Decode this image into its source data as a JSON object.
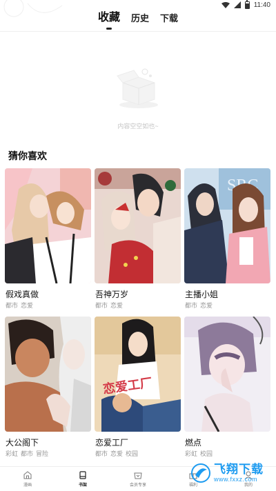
{
  "status_bar": {
    "time": "11:40"
  },
  "header": {
    "tabs": [
      {
        "label": "收藏",
        "active": true
      },
      {
        "label": "历史",
        "active": false
      },
      {
        "label": "下载",
        "active": false
      }
    ]
  },
  "empty_state": {
    "text": "内容空空如也~"
  },
  "recommend": {
    "title": "猜你喜欢",
    "items": [
      {
        "title": "假戏真做",
        "tags": [
          "都市",
          "恋爱"
        ]
      },
      {
        "title": "吾神万岁",
        "tags": [
          "都市",
          "恋爱"
        ]
      },
      {
        "title": "主播小姐",
        "tags": [
          "都市",
          "恋爱"
        ]
      },
      {
        "title": "大公阁下",
        "tags": [
          "彩虹",
          "都市",
          "冒险"
        ]
      },
      {
        "title": "恋爱工厂",
        "tags": [
          "都市",
          "恋爱",
          "校园"
        ]
      },
      {
        "title": "燃点",
        "tags": [
          "彩虹",
          "校园"
        ]
      }
    ],
    "cover_texts": {
      "src": "SRC",
      "factory": "恋爱工厂"
    }
  },
  "bottom_nav": {
    "items": [
      {
        "label": "漫画",
        "icon": "home-icon",
        "active": false
      },
      {
        "label": "书架",
        "icon": "bookshelf-icon",
        "active": true
      },
      {
        "label": "会员专享",
        "icon": "vip-icon",
        "active": false
      },
      {
        "label": "福利",
        "icon": "gift-icon",
        "active": false
      },
      {
        "label": "我的",
        "icon": "profile-icon",
        "active": false
      }
    ]
  },
  "watermark": {
    "cn": "飞翔下载",
    "en": "www.fxxz.com"
  },
  "colors": {
    "accent": "#222222",
    "tag": "#999999",
    "watermark": "#1d9bf0"
  }
}
